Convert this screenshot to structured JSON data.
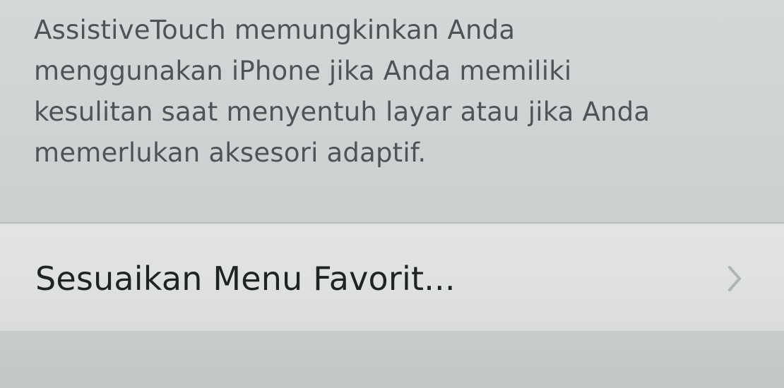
{
  "assistive_touch": {
    "footer_lines": [
      "AssistiveTouch memungkinkan Anda",
      "menggunakan iPhone jika Anda memiliki",
      "kesulitan saat menyentuh layar atau jika Anda",
      "memerlukan aksesori adaptif."
    ]
  },
  "cells": [
    {
      "label": "Sesuaikan Menu Favorit...",
      "accessory": "chevron-right-icon"
    }
  ],
  "colors": {
    "background": "#c9cccd",
    "cell_background": "#e0e2e1",
    "footer_text": "#4f5355",
    "cell_text": "#202324",
    "separator": "#b9bcbd",
    "chevron": "#b2b5b6"
  }
}
